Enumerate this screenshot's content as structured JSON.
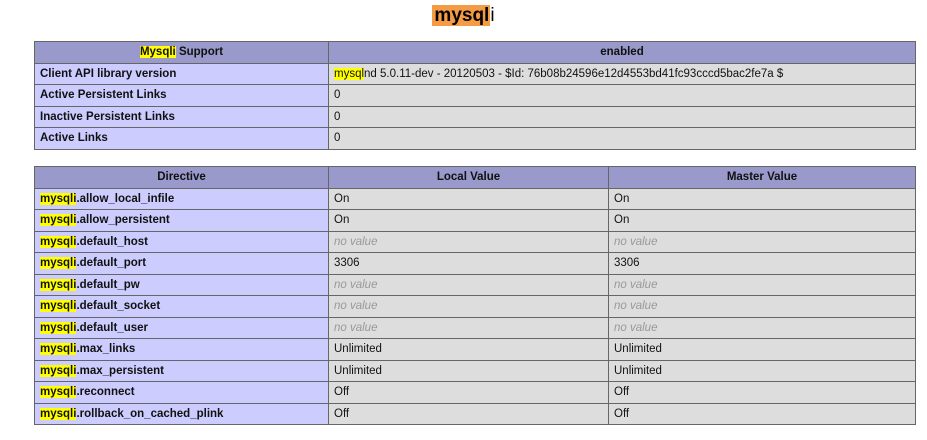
{
  "title": {
    "highlight": "mysql",
    "rest": "i"
  },
  "support": {
    "header": {
      "highlight": "Mysqli",
      "rest": " Support",
      "value": "enabled"
    },
    "rows": [
      {
        "label": "Client API library version",
        "value_highlight": "mysql",
        "value": "nd 5.0.11-dev - 20120503 - $Id: 76b08b24596e12d4553bd41fc93cccd5bac2fe7a $"
      },
      {
        "label": "Active Persistent Links",
        "value_highlight": "",
        "value": "0"
      },
      {
        "label": "Inactive Persistent Links",
        "value_highlight": "",
        "value": "0"
      },
      {
        "label": "Active Links",
        "value_highlight": "",
        "value": "0"
      }
    ]
  },
  "directives": {
    "headers": {
      "directive": "Directive",
      "local": "Local Value",
      "master": "Master Value"
    },
    "rows": [
      {
        "prefix": "mysqli",
        "name": ".allow_local_infile",
        "local": "On",
        "master": "On",
        "novalue": false
      },
      {
        "prefix": "mysqli",
        "name": ".allow_persistent",
        "local": "On",
        "master": "On",
        "novalue": false
      },
      {
        "prefix": "mysqli",
        "name": ".default_host",
        "local": "no value",
        "master": "no value",
        "novalue": true
      },
      {
        "prefix": "mysqli",
        "name": ".default_port",
        "local": "3306",
        "master": "3306",
        "novalue": false
      },
      {
        "prefix": "mysqli",
        "name": ".default_pw",
        "local": "no value",
        "master": "no value",
        "novalue": true
      },
      {
        "prefix": "mysqli",
        "name": ".default_socket",
        "local": "no value",
        "master": "no value",
        "novalue": true
      },
      {
        "prefix": "mysqli",
        "name": ".default_user",
        "local": "no value",
        "master": "no value",
        "novalue": true
      },
      {
        "prefix": "mysqli",
        "name": ".max_links",
        "local": "Unlimited",
        "master": "Unlimited",
        "novalue": false
      },
      {
        "prefix": "mysqli",
        "name": ".max_persistent",
        "local": "Unlimited",
        "master": "Unlimited",
        "novalue": false
      },
      {
        "prefix": "mysqli",
        "name": ".reconnect",
        "local": "Off",
        "master": "Off",
        "novalue": false
      },
      {
        "prefix": "mysqli",
        "name": ".rollback_on_cached_plink",
        "local": "Off",
        "master": "Off",
        "novalue": false
      }
    ]
  },
  "colors": {
    "header_bg": "#9999cc",
    "label_bg": "#ccccff",
    "value_bg": "#dddddd",
    "search_highlight": "#ffff00",
    "current_match_highlight": "#f59b44"
  }
}
